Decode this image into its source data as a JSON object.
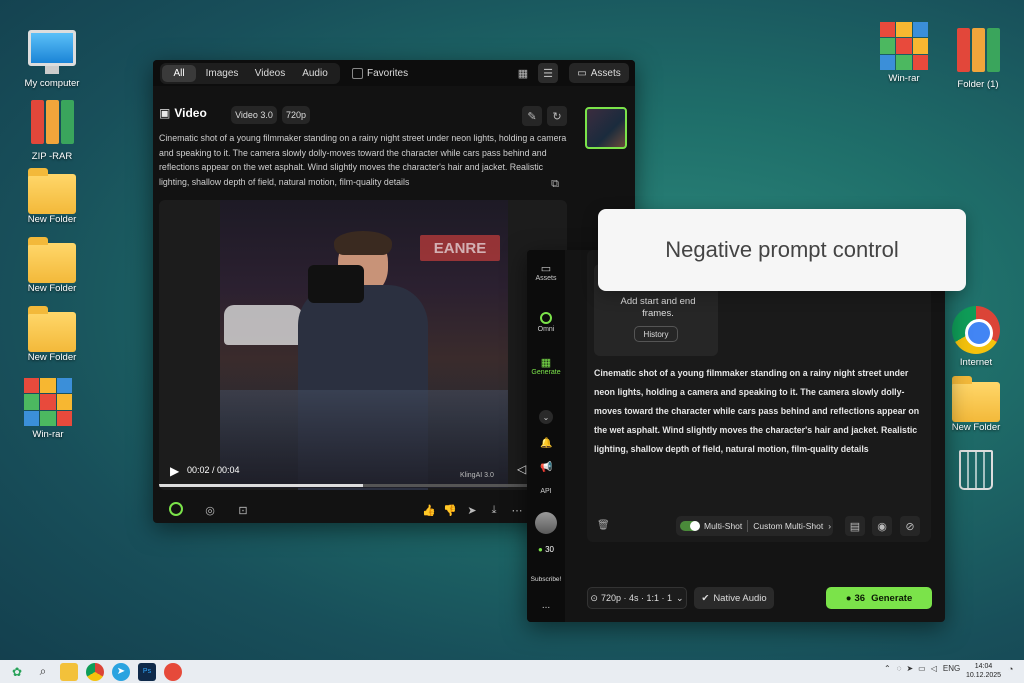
{
  "desktop": {
    "left_icons": [
      {
        "label": "My computer",
        "icon": "monitor-icon"
      },
      {
        "label": "ZIP -RAR",
        "icon": "binders-icon"
      },
      {
        "label": "New Folder",
        "icon": "folder-icon"
      },
      {
        "label": "New Folder",
        "icon": "folder-icon"
      },
      {
        "label": "New Folder",
        "icon": "folder-icon"
      },
      {
        "label": "Win-rar",
        "icon": "winrar-icon"
      }
    ],
    "right_icons": [
      {
        "label": "Win-rar",
        "icon": "winrar-icon"
      },
      {
        "label": "Folder (1)",
        "icon": "binders-icon"
      },
      {
        "label": "Internet",
        "icon": "chrome-icon"
      },
      {
        "label": "New Folder",
        "icon": "folder-icon"
      },
      {
        "label": "",
        "icon": "recycle-bin-icon"
      }
    ]
  },
  "library": {
    "filters": [
      "All",
      "Images",
      "Videos",
      "Audio"
    ],
    "active_filter": "All",
    "favorites_label": "Favorites",
    "assets_label": "Assets",
    "video_title": "Video",
    "model_badge": "Video 3.0",
    "resolution_badge": "720p",
    "prompt": "Cinematic shot of a young filmmaker standing on a rainy night street under neon lights, holding a camera and speaking to it. The camera slowly dolly-moves toward the character while cars pass behind and reflections appear on the wet asphalt. Wind slightly moves the character's hair and jacket. Realistic lighting, shallow depth of field, natural motion, film-quality details",
    "player_time": "00:02 / 00:04",
    "watermark": "KlingAI 3.0",
    "progress_pct": 50,
    "scene_sign": "EANRE"
  },
  "sidebar": {
    "assets": "Assets",
    "omni": "Omni",
    "generate": "Generate",
    "api": "API",
    "credits": "30",
    "subscribe": "Subscribe!",
    "more": "..."
  },
  "generator": {
    "frames_hint": "Add start and end frames.",
    "history_label": "History",
    "prompt": "Cinematic shot of a young filmmaker standing on a rainy night street under neon lights, holding a camera and speaking to it. The camera slowly dolly-moves toward the character while cars pass behind and reflections appear on the wet asphalt. Wind slightly moves the character's hair and jacket. Realistic lighting, shallow depth of field, natural motion, film-quality details",
    "multishot_label": "Multi-Shot",
    "custom_multishot_label": "Custom Multi-Shot",
    "settings_label": "720p · 4s · 1:1 · 1",
    "native_audio_label": "Native Audio",
    "generate_cost": "36",
    "generate_label": "Generate",
    "accent_color": "#7be34a"
  },
  "callout": {
    "text": "Negative prompt control"
  },
  "taskbar": {
    "lang": "ENG",
    "time": "14:04",
    "date": "10.12.2025"
  }
}
